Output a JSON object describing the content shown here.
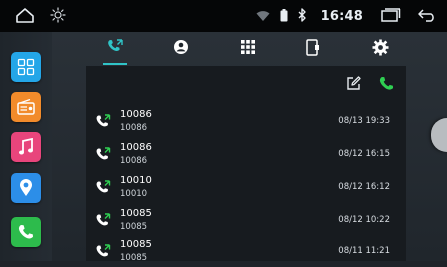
{
  "status_bar": {
    "time": "16:48",
    "icons": [
      "home-outline-icon",
      "brightness-icon",
      "wifi-icon",
      "battery-icon",
      "bluetooth-icon",
      "recent-apps-icon",
      "back-icon"
    ]
  },
  "sidebar": {
    "apps": [
      {
        "name": "apps-grid-icon",
        "color": "#24a6e8"
      },
      {
        "name": "radio-icon",
        "color": "#f28b2b"
      },
      {
        "name": "music-icon",
        "color": "#e8457c"
      },
      {
        "name": "navigation-icon",
        "color": "#2c8ee8"
      },
      {
        "name": "phone-icon",
        "color": "#2dbb4c"
      }
    ]
  },
  "tabs": [
    {
      "name": "call-log-tab",
      "icon": "call-log-icon",
      "active": true
    },
    {
      "name": "contacts-tab",
      "icon": "contact-icon",
      "active": false
    },
    {
      "name": "dialpad-tab",
      "icon": "dialpad-icon",
      "active": false
    },
    {
      "name": "device-tab",
      "icon": "phone-device-icon",
      "active": false
    },
    {
      "name": "settings-tab",
      "icon": "settings-icon",
      "active": false
    }
  ],
  "toolbar": {
    "edit_icon": "edit-icon",
    "call_icon": "call-icon"
  },
  "call_log": [
    {
      "name": "10086",
      "number": "10086",
      "datetime": "08/13 19:33"
    },
    {
      "name": "10086",
      "number": "10086",
      "datetime": "08/12 16:15"
    },
    {
      "name": "10010",
      "number": "10010",
      "datetime": "08/12 16:12"
    },
    {
      "name": "10085",
      "number": "10085",
      "datetime": "08/12 10:22"
    },
    {
      "name": "10085",
      "number": "10085",
      "datetime": "08/11 11:21"
    }
  ],
  "colors": {
    "accent": "#30c4c7",
    "call_green": "#2fcf52",
    "panel_bg": "#171b1f",
    "status_bg": "#050607"
  }
}
